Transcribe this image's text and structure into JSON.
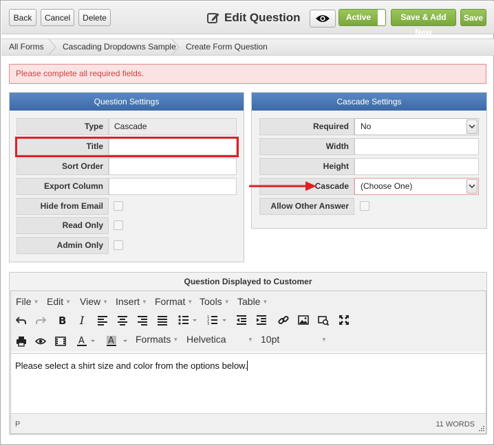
{
  "header": {
    "back_label": "Back",
    "cancel_label": "Cancel",
    "delete_label": "Delete",
    "title": "Edit Question",
    "active_label": "Active",
    "save_add_new_label": "Save & Add New",
    "save_label": "Save"
  },
  "breadcrumb": [
    "All Forms",
    "Cascading Dropdowns Sample",
    "Create Form Question"
  ],
  "alert": "Please complete all required fields.",
  "question_settings": {
    "header": "Question Settings",
    "rows": [
      {
        "label": "Type",
        "value": "Cascade"
      },
      {
        "label": "Title",
        "value": ""
      },
      {
        "label": "Sort Order",
        "value": ""
      },
      {
        "label": "Export Column",
        "value": ""
      },
      {
        "label": "Hide from Email"
      },
      {
        "label": "Read Only"
      },
      {
        "label": "Admin Only"
      }
    ]
  },
  "cascade_settings": {
    "header": "Cascade Settings",
    "rows": [
      {
        "label": "Required",
        "value": "No"
      },
      {
        "label": "Width",
        "value": ""
      },
      {
        "label": "Height",
        "value": ""
      },
      {
        "label": "Cascade",
        "value": "(Choose One)"
      },
      {
        "label": "Allow Other Answer"
      }
    ]
  },
  "editor": {
    "header": "Question Displayed to Customer",
    "menus": [
      "File",
      "Edit",
      "View",
      "Insert",
      "Format",
      "Tools",
      "Table"
    ],
    "formats_label": "Formats",
    "font_family": "Helvetica",
    "font_size": "10pt",
    "font_color_letter": "A",
    "bg_color_letter": "A",
    "content": "Please select a shirt size and color from the options below.",
    "path": "P",
    "word_count": "11 WORDS"
  },
  "colors": {
    "accent_green": "#8cb84b",
    "panel_header_blue": "#4a77b4",
    "alert_text": "#d0423f",
    "highlight_red": "#e01f26"
  }
}
